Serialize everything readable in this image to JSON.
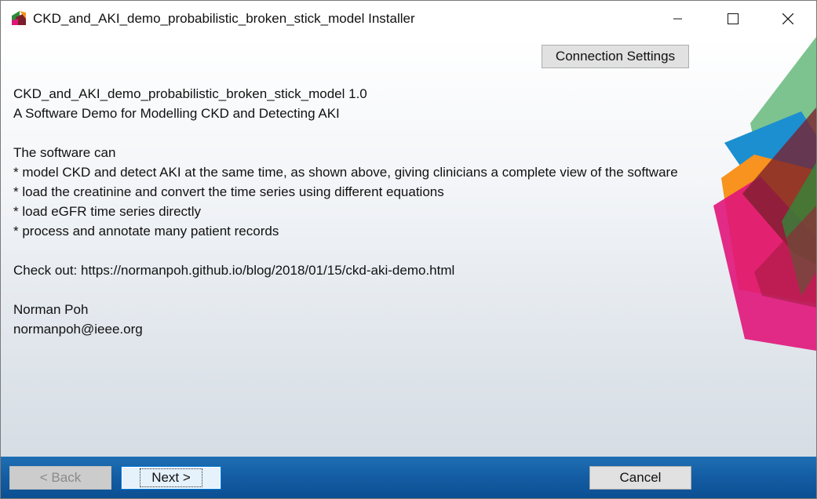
{
  "window": {
    "title": "CKD_and_AKI_demo_probabilistic_broken_stick_model Installer",
    "controls": {
      "minimize": "minimize-icon",
      "maximize": "maximize-icon",
      "close": "close-icon"
    }
  },
  "connection_settings": {
    "label": "Connection Settings"
  },
  "info": {
    "product_line": "CKD_and_AKI_demo_probabilistic_broken_stick_model 1.0",
    "subtitle": "A Software Demo for Modelling CKD and Detecting AKI",
    "intro": "The software can",
    "bullets": [
      "* model CKD and detect AKI at the same time, as shown above, giving clinicians a complete view of the software",
      "* load the creatinine and convert the time series using different equations",
      "* load eGFR time series directly",
      "* process and annotate many patient records"
    ],
    "check_out": "Check out: https://normanpoh.github.io/blog/2018/01/15/ckd-aki-demo.html",
    "author": "Norman Poh",
    "email": "normanpoh@ieee.org"
  },
  "footer": {
    "back_label": "< Back",
    "next_label": "Next >",
    "cancel_label": "Cancel"
  },
  "colors": {
    "footer_blue": "#145ea5",
    "decor_green": "#7cc38f",
    "decor_orange": "#f7931e",
    "decor_magenta": "#e0157a",
    "decor_blue": "#1b8fd0"
  }
}
